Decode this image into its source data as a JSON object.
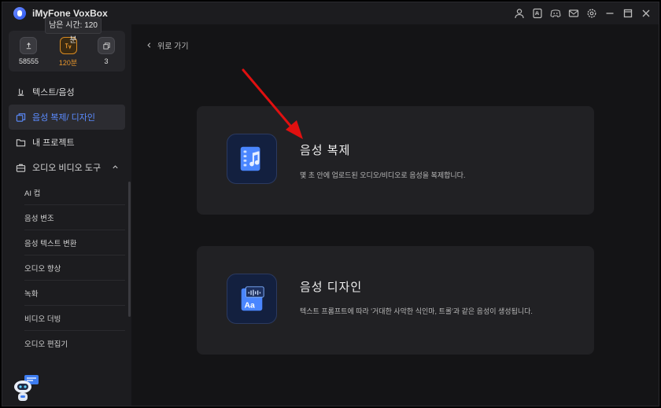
{
  "app": {
    "title": "iMyFone VoxBox"
  },
  "tooltip": {
    "text": "남은 시간: 120분"
  },
  "stats": [
    {
      "icon": "refresh-icon",
      "value": "58555"
    },
    {
      "icon": "time-icon",
      "value": "120분"
    },
    {
      "icon": "copy-icon",
      "value": "3"
    }
  ],
  "sidebar": {
    "items": [
      {
        "label": "텍스트/음성",
        "icon": "tts-icon"
      },
      {
        "label": "음성 복제/ 디자인",
        "icon": "clone-icon"
      },
      {
        "label": "내 프로젝트",
        "icon": "folder-icon"
      },
      {
        "label": "오디오 비디오 도구",
        "icon": "toolbox-icon"
      }
    ],
    "subitems": [
      {
        "label": "AI 컵"
      },
      {
        "label": "음성 변조"
      },
      {
        "label": "음성 텍스트 변환"
      },
      {
        "label": "오디오 향상"
      },
      {
        "label": "녹화"
      },
      {
        "label": "비디오 더빙"
      },
      {
        "label": "오디오 편집기"
      }
    ]
  },
  "main": {
    "back_label": "위로 가기",
    "cards": [
      {
        "title": "음성 복제",
        "desc": "몇 초 안에 업로드된 오디오/비디오로 음성을 복제합니다."
      },
      {
        "title": "음성 디자인",
        "desc": "텍스트 프롬프트에 따라 '거대한 사악한 식인마, 트롤'과 같은 음성이 생성됩니다."
      }
    ]
  },
  "colors": {
    "accent": "#5b8cff",
    "highlight": "#e8962c",
    "arrow": "#e01010"
  }
}
